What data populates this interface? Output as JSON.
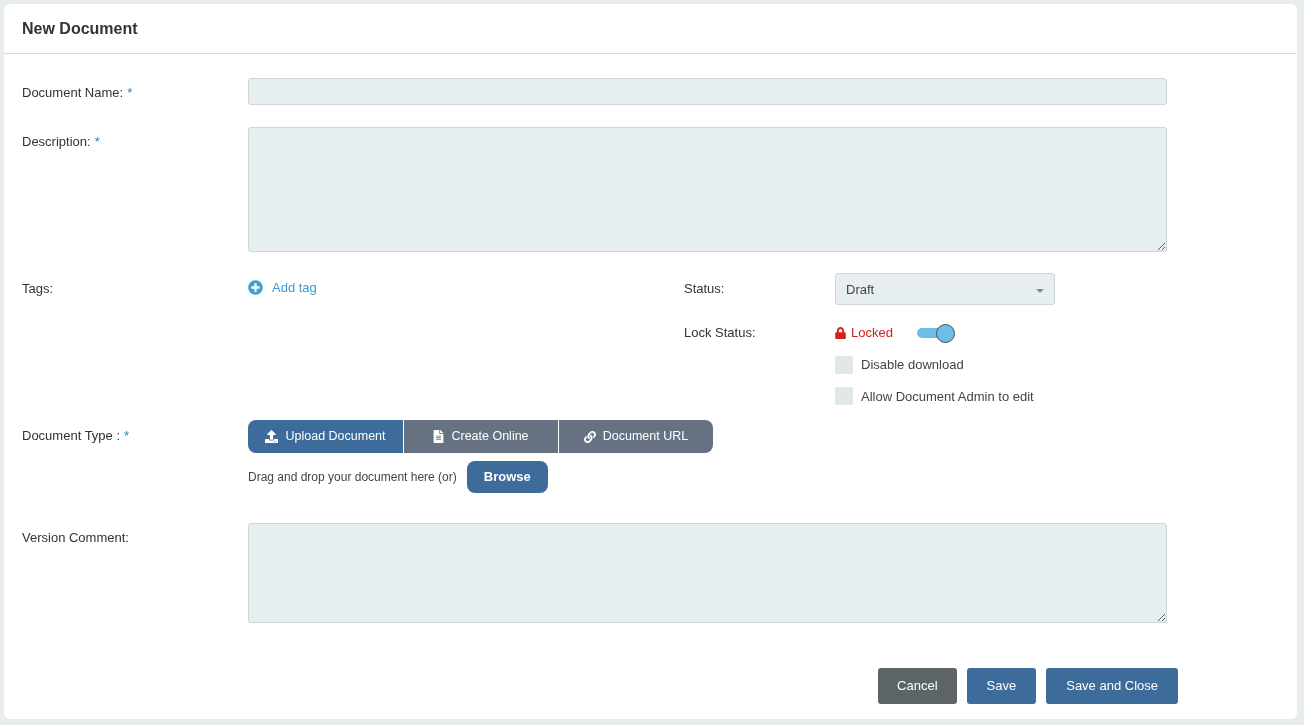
{
  "title": "New Document",
  "document_name": {
    "label": "Document Name:",
    "required_mark": "*"
  },
  "description": {
    "label": "Description:",
    "required_mark": "*"
  },
  "tags": {
    "label": "Tags:",
    "add_link": "Add tag"
  },
  "status": {
    "label": "Status:",
    "value": "Draft"
  },
  "lock_status": {
    "label": "Lock Status:",
    "state_text": "Locked",
    "on": true
  },
  "checkboxes": [
    {
      "label": "Disable download",
      "checked": false
    },
    {
      "label": "Allow Document Admin to edit",
      "checked": false
    }
  ],
  "document_type": {
    "label": "Document Type :",
    "required_mark": "*",
    "options": [
      {
        "label": "Upload Document",
        "kind": "upload",
        "selected": true
      },
      {
        "label": "Create Online",
        "kind": "file",
        "selected": false
      },
      {
        "label": "Document URL",
        "kind": "link",
        "selected": false
      }
    ],
    "drop_hint": "Drag and drop your document here (or)",
    "browse": "Browse"
  },
  "version_comment": {
    "label": "Version Comment:"
  },
  "buttons": [
    {
      "label": "Cancel",
      "kind": "secondary"
    },
    {
      "label": "Save",
      "kind": "primary"
    },
    {
      "label": "Save and Close",
      "kind": "primary"
    }
  ]
}
